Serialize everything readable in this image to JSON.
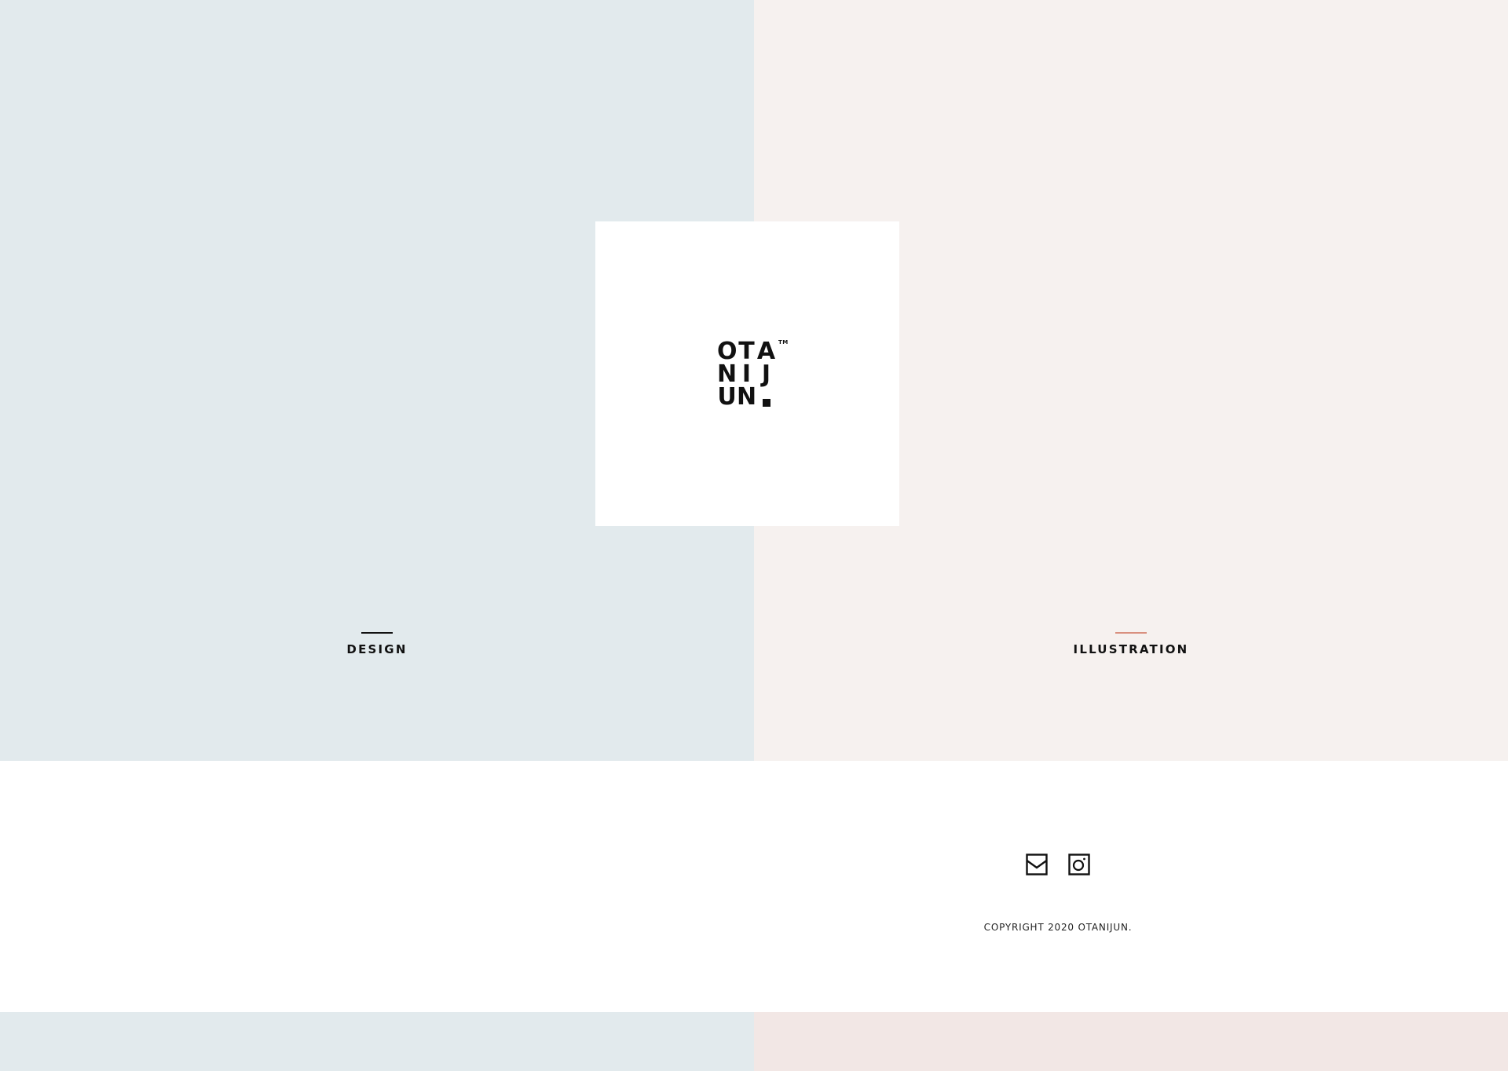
{
  "logo": {
    "rows": [
      [
        "O",
        "T",
        "A"
      ],
      [
        "N",
        "I",
        "J"
      ],
      [
        "U",
        "N"
      ]
    ],
    "trademark": "TM",
    "text": "OTANIJUN."
  },
  "nav": {
    "design": {
      "label": "DESIGN",
      "line_color": "#111111"
    },
    "illustration": {
      "label": "ILLUSTRATION",
      "line_color": "#d9907f"
    }
  },
  "footer": {
    "icons": [
      "mail-icon",
      "instagram-icon"
    ],
    "copyright": "COPYRIGHT 2020 OTANIJUN."
  },
  "colors": {
    "left_panel": "#e2eaed",
    "right_panel": "#f6f1ef",
    "bottom_right": "#f2e7e5",
    "text": "#111111",
    "illustration_accent": "#d9907f"
  }
}
